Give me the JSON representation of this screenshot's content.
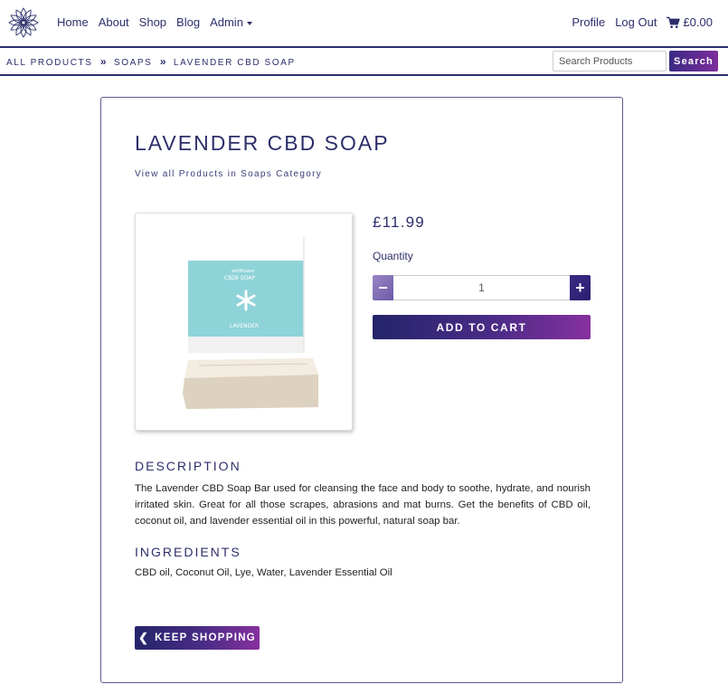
{
  "nav": {
    "home": "Home",
    "about": "About",
    "shop": "Shop",
    "blog": "Blog",
    "admin": "Admin",
    "profile": "Profile",
    "logout": "Log Out",
    "cart_total": "£0.00"
  },
  "breadcrumb": {
    "all_products": "ALL PRODUCTS",
    "category": "SOAPS",
    "current": "LAVENDER CBD SOAP",
    "separator": "»"
  },
  "search": {
    "placeholder": "Search Products",
    "button": "Search"
  },
  "product": {
    "title": "LAVENDER CBD SOAP",
    "category_link": "View all Products in Soaps Category",
    "price": "£11.99",
    "quantity_label": "Quantity",
    "quantity_value": "1",
    "add_to_cart": "ADD TO CART",
    "image_box_brand": "wildflower",
    "image_box_name": "CBDⅡ SOAP",
    "image_box_variant": "LAVENDER"
  },
  "description": {
    "heading": "DESCRIPTION",
    "text": "The Lavender CBD Soap Bar used for cleansing the face and body to soothe, hydrate, and nourish irritated skin. Great for all those scrapes, abrasions and mat burns. Get the benefits of CBD oil, coconut oil, and lavender essential oil in this powerful, natural soap bar."
  },
  "ingredients": {
    "heading": "INGREDIENTS",
    "text": "CBD oil, Coconut Oil, Lye, Water, Lavender Essential Oil"
  },
  "actions": {
    "keep_shopping": "KEEP SHOPPING"
  },
  "icons": {
    "logo": "mandala-flower-logo",
    "cart": "shopping-cart-icon",
    "chevron": "chevron-left-icon"
  },
  "colors": {
    "brand_navy": "#2d2f6b",
    "gradient_start": "#24246a",
    "gradient_end": "#86309f",
    "soap_box_teal": "#8ed3d8"
  }
}
